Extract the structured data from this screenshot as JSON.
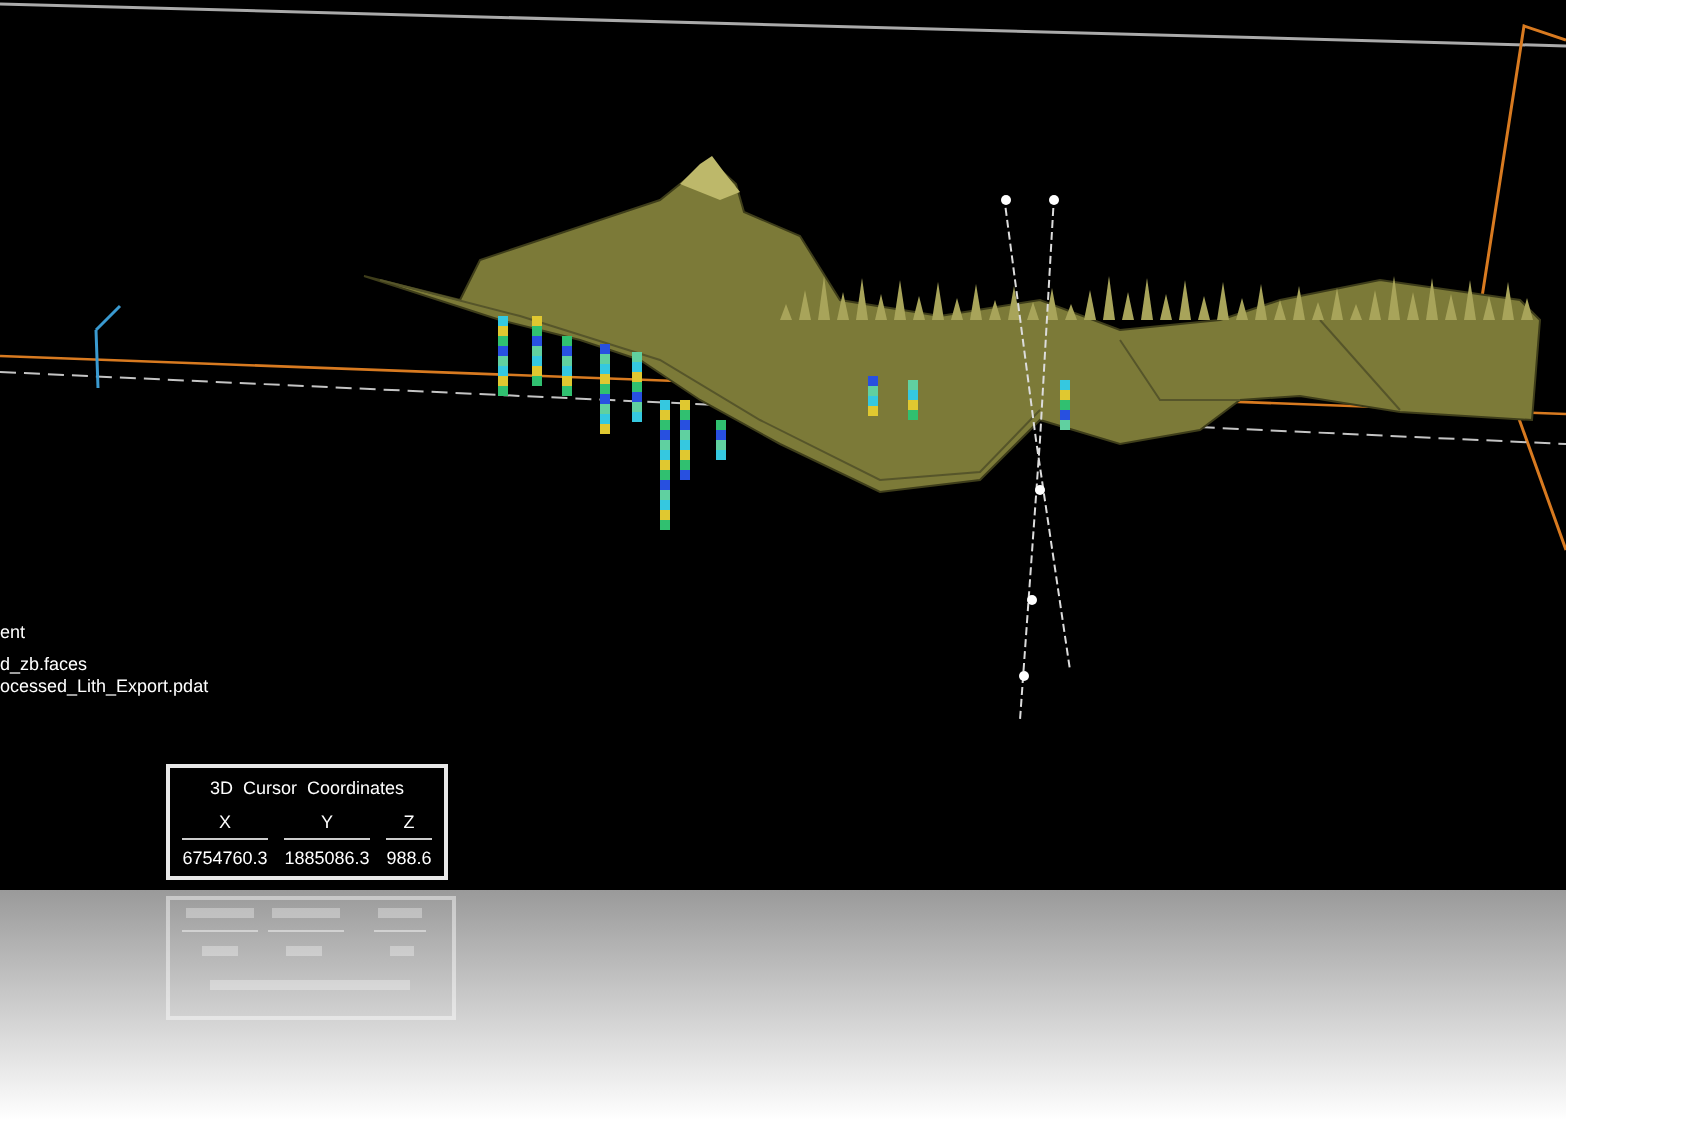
{
  "viewport": {
    "legend": [
      "ent",
      "d_zb.faces",
      "ocessed_Lith_Export.pdat"
    ]
  },
  "cursor_panel": {
    "title": "3D  Cursor  Coordinates",
    "columns": [
      {
        "label": "X",
        "value": "6754760.3"
      },
      {
        "label": "Y",
        "value": "1885086.3"
      },
      {
        "label": "Z",
        "value": "988.6"
      }
    ]
  }
}
